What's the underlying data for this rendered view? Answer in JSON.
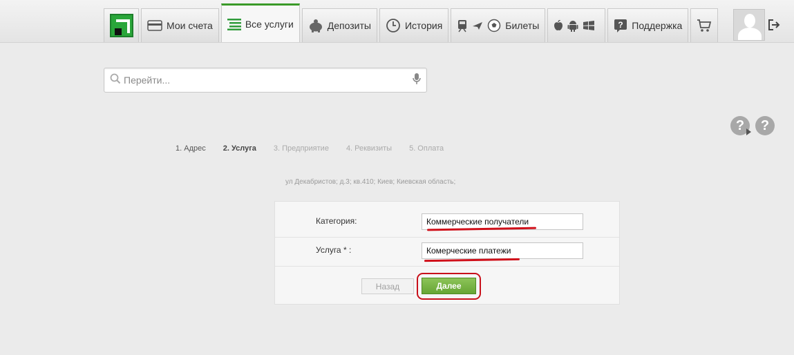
{
  "nav": {
    "accounts": "Мои счета",
    "all_services": "Все услуги",
    "deposits": "Депозиты",
    "history": "История",
    "tickets": "Билеты",
    "support": "Поддержка"
  },
  "search": {
    "placeholder": "Перейти..."
  },
  "steps": [
    "1. Адрес",
    "2. Услуга",
    "3. Предприятие",
    "4. Реквизиты",
    "5. Оплата"
  ],
  "address": "ул Декабристов; д.3; кв.410; Киев; Киевская область;",
  "form": {
    "category_label": "Категория:",
    "category_value": "Коммерческие получатели",
    "service_label": "Услуга * :",
    "service_value": "Комерческие платежи",
    "back_label": "Назад",
    "next_label": "Далее"
  },
  "help": {
    "label": "?"
  },
  "colors": {
    "accent_green": "#3a9a28",
    "button_green": "#67a535",
    "annotation_red": "#d0101a"
  },
  "icons": [
    "logo-icon",
    "card-icon",
    "list-icon",
    "piggy-bank-icon",
    "clock-icon",
    "train-icon",
    "plane-icon",
    "ball-icon",
    "apple-icon",
    "android-icon",
    "windows-icon",
    "support-icon",
    "cart-icon",
    "search-icon",
    "microphone-icon",
    "exit-icon",
    "help-icon"
  ]
}
